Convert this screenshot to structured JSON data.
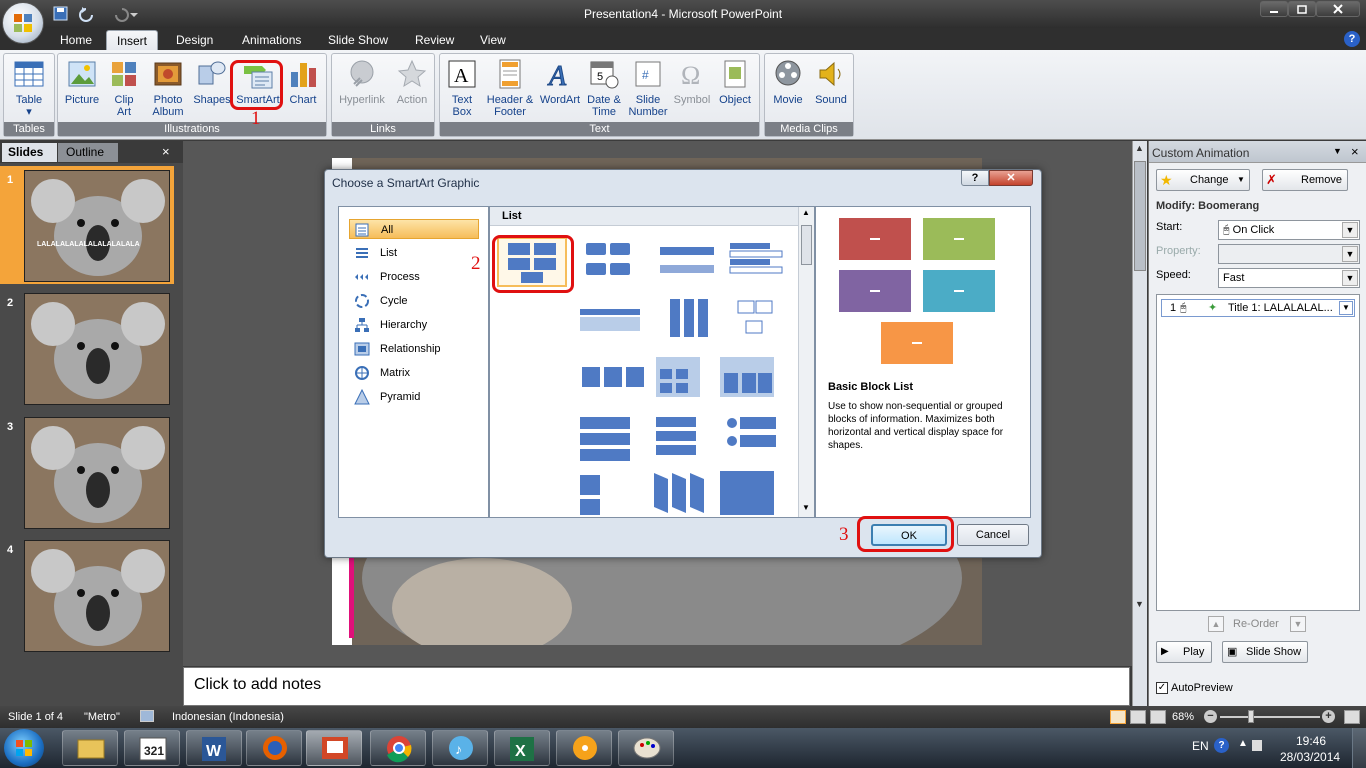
{
  "window": {
    "title": "Presentation4 - Microsoft PowerPoint"
  },
  "tabs": [
    "Home",
    "Insert",
    "Design",
    "Animations",
    "Slide Show",
    "Review",
    "View"
  ],
  "ribbon": {
    "groups": [
      {
        "label": "Tables",
        "buttons": [
          "Table"
        ]
      },
      {
        "label": "Illustrations",
        "buttons": [
          "Picture",
          "Clip Art",
          "Photo Album",
          "Shapes",
          "SmartArt",
          "Chart"
        ]
      },
      {
        "label": "Links",
        "buttons": [
          "Hyperlink",
          "Action"
        ]
      },
      {
        "label": "Text",
        "buttons": [
          "Text Box",
          "Header & Footer",
          "WordArt",
          "Date & Time",
          "Slide Number",
          "Symbol",
          "Object"
        ]
      },
      {
        "label": "Media Clips",
        "buttons": [
          "Movie",
          "Sound"
        ]
      }
    ]
  },
  "leftpane": {
    "tabs": [
      "Slides",
      "Outline"
    ],
    "slide_numbers": [
      "1",
      "2",
      "3",
      "4"
    ],
    "slide1_text": "LALALALALALALALALALALA"
  },
  "notes": {
    "placeholder": "Click to add notes"
  },
  "dialog": {
    "title": "Choose a SmartArt Graphic",
    "categories": [
      "All",
      "List",
      "Process",
      "Cycle",
      "Hierarchy",
      "Relationship",
      "Matrix",
      "Pyramid"
    ],
    "gallery_header": "List",
    "preview_title": "Basic Block List",
    "preview_description": "Use to show non-sequential or grouped blocks of information. Maximizes both horizontal and vertical display space for shapes.",
    "preview_colors": [
      "#c0504d",
      "#9bbb59",
      "#8064a2",
      "#4bacc6",
      "#f79646"
    ],
    "ok": "OK",
    "cancel": "Cancel"
  },
  "annotations": [
    "1",
    "2",
    "3"
  ],
  "animpane": {
    "title": "Custom Animation",
    "change": "Change",
    "remove": "Remove",
    "modify": "Modify: Boomerang",
    "start_label": "Start:",
    "start_value": "On Click",
    "property_label": "Property:",
    "property_value": "",
    "speed_label": "Speed:",
    "speed_value": "Fast",
    "item_number": "1",
    "item_label": "Title 1: LALALALAL...",
    "reorder": "Re-Order",
    "play": "Play",
    "slideshow": "Slide Show",
    "autopreview": "AutoPreview"
  },
  "status": {
    "slide": "Slide 1 of 4",
    "theme": "\"Metro\"",
    "language": "Indonesian (Indonesia)",
    "zoom": "68%"
  },
  "taskbar": {
    "lang": "EN",
    "time": "19:46",
    "date": "28/03/2014"
  }
}
